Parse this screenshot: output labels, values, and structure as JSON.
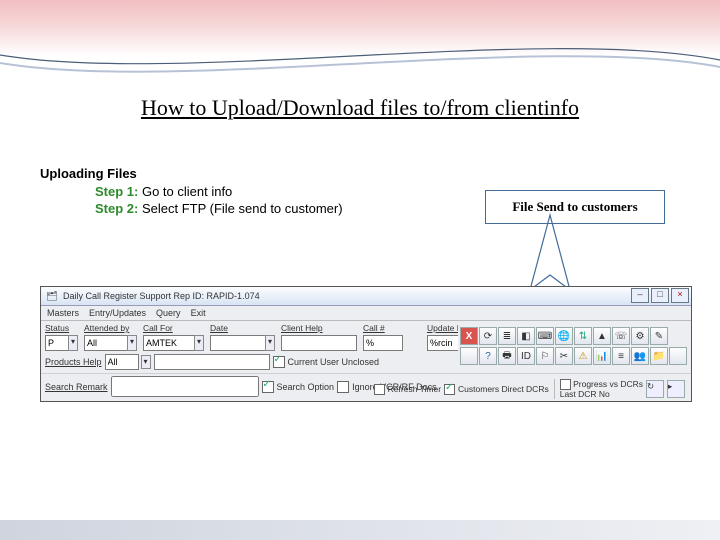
{
  "title": "How to Upload/Download files to/from clientinfo",
  "section_heading": "Uploading Files",
  "steps": [
    {
      "label": "Step 1:",
      "text": " Go to client info"
    },
    {
      "label": "Step 2:",
      "text": " Select FTP (File send to customer)"
    }
  ],
  "callout": "File Send to customers",
  "app": {
    "title": "Daily Call Register   Support Rep ID: RAPID-1.074",
    "menus": [
      "Masters",
      "Entry/Updates",
      "Query",
      "Exit"
    ],
    "filter_labels": {
      "status": "Status",
      "attended": "Attended by",
      "callfor": "Call For",
      "date": "Date",
      "client": "Client Help",
      "callno": "Call #",
      "products": "Products Help",
      "search": "Search Remark",
      "updatedt": "Update Dt."
    },
    "filter_values": {
      "status": "P",
      "attended": "All",
      "callfor": "AMTEK",
      "date": "",
      "client": "",
      "callno": "%",
      "products": "All",
      "search": ""
    },
    "update_label": "%rcin",
    "checkboxes": {
      "current_user": "Current User Unclosed",
      "search_option": "Search Option",
      "ignore": "Ignore VCR/RF Docs",
      "refresh": "Refresh Timer",
      "cust": "Customers Direct DCRs",
      "progress": "Progress vs DCRs"
    },
    "last": "Last DCR No",
    "toolbar_icons": [
      "excel-icon",
      "refresh-icon",
      "script-icon",
      "remote-icon",
      "telnet-icon",
      "globe-icon",
      "ftp-icon",
      "shield-icon",
      "phone-icon",
      "gear-icon",
      "note-icon",
      "x1",
      "help-icon",
      "print-icon",
      "id-icon",
      "flag-icon",
      "tool-icon",
      "warn-icon",
      "chart-icon",
      "db-icon",
      "users-icon",
      "folder-icon",
      "x2"
    ],
    "toolbar_glyphs": [
      "X",
      "⟳",
      "≣",
      "◧",
      "⌨",
      "🌐",
      "⇅",
      "▲",
      "☏",
      "⚙",
      "✎",
      "",
      "?",
      "🖶",
      "ID",
      "⚐",
      "✂",
      "⚠",
      "📊",
      "≡",
      "👥",
      "📁",
      ""
    ],
    "colors": {
      "ftp_highlight": "#d9534f"
    }
  }
}
